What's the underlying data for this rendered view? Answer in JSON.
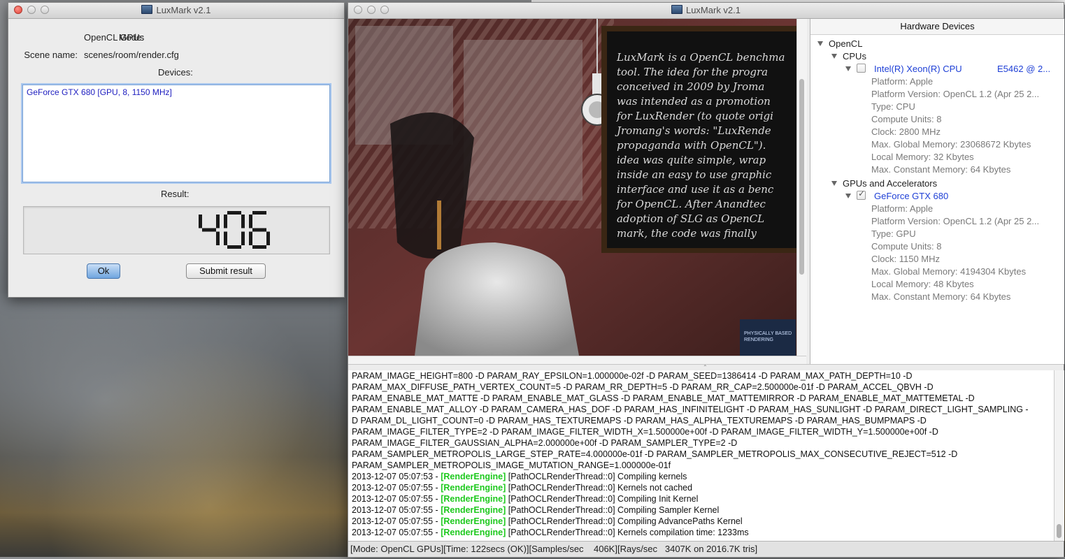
{
  "result_window": {
    "title": "LuxMark v2.1",
    "mode_label": "Mode:",
    "mode_value": "OpenCL GPUs",
    "scene_label": "Scene name:",
    "scene_value": "scenes/room/render.cfg",
    "devices_label": "Devices:",
    "devices": [
      "GeForce GTX 680 [GPU, 8, 1150 MHz]"
    ],
    "result_label": "Result:",
    "result_value": "406",
    "ok_button": "Ok",
    "submit_button": "Submit result"
  },
  "main_window": {
    "title": "LuxMark v2.1",
    "hardware_header": "Hardware Devices",
    "tree": {
      "opencl": "OpenCL",
      "cpus": "CPUs",
      "cpu_device": {
        "name": "Intel(R) Xeon(R) CPU",
        "model": "E5462  @ 2...",
        "checked": false,
        "props": [
          "Platform: Apple",
          "Platform Version: OpenCL 1.2 (Apr 25 2...",
          "Type: CPU",
          "Compute Units: 8",
          "Clock: 2800 MHz",
          "Max. Global Memory: 23068672 Kbytes",
          "Local Memory: 32 Kbytes",
          "Max. Constant Memory: 64 Kbytes"
        ]
      },
      "gpus": "GPUs and Accelerators",
      "gpu_device": {
        "name": "GeForce GTX 680",
        "checked": true,
        "props": [
          "Platform: Apple",
          "Platform Version: OpenCL 1.2 (Apr 25 2...",
          "Type: GPU",
          "Compute Units: 8",
          "Clock: 1150 MHz",
          "Max. Global Memory: 4194304 Kbytes",
          "Local Memory: 48 Kbytes",
          "Max. Constant Memory: 64 Kbytes"
        ]
      }
    },
    "chalkboard_text": [
      "LuxMark is a OpenCL benchma",
      "tool. The idea for the progra",
      "conceived in 2009 by Jroma",
      "was intended as a promotion",
      "for LuxRender (to quote origi",
      "Jromang's words: \"LuxRende",
      "propaganda with OpenCL\").",
      "idea was quite simple, wrap",
      "inside an easy to use graphic",
      "interface and use it as a benc",
      "for OpenCL. After Anandtec",
      "adoption of SLG as OpenCL",
      "mark, the code was finally"
    ],
    "book_text": [
      "PHYSICALLY BASED",
      "RENDERING"
    ],
    "log_lines": [
      {
        "text": "PARAM_IMAGE_HEIGHT=800 -D PARAM_RAY_EPSILON=1.000000e-02f -D PARAM_SEED=1386414 -D PARAM_MAX_PATH_DEPTH=10 -D"
      },
      {
        "text": "PARAM_MAX_DIFFUSE_PATH_VERTEX_COUNT=5 -D PARAM_RR_DEPTH=5 -D PARAM_RR_CAP=2.500000e-01f -D PARAM_ACCEL_QBVH -D"
      },
      {
        "text": "PARAM_ENABLE_MAT_MATTE -D PARAM_ENABLE_MAT_GLASS -D PARAM_ENABLE_MAT_MATTEMIRROR -D PARAM_ENABLE_MAT_MATTEMETAL -D"
      },
      {
        "text": "PARAM_ENABLE_MAT_ALLOY -D PARAM_CAMERA_HAS_DOF -D PARAM_HAS_INFINITELIGHT -D PARAM_HAS_SUNLIGHT -D PARAM_DIRECT_LIGHT_SAMPLING -"
      },
      {
        "text": "D PARAM_DL_LIGHT_COUNT=0 -D PARAM_HAS_TEXTUREMAPS -D PARAM_HAS_ALPHA_TEXTUREMAPS -D PARAM_HAS_BUMPMAPS -D"
      },
      {
        "text": "PARAM_IMAGE_FILTER_TYPE=2 -D PARAM_IMAGE_FILTER_WIDTH_X=1.500000e+00f -D PARAM_IMAGE_FILTER_WIDTH_Y=1.500000e+00f -D"
      },
      {
        "text": "PARAM_IMAGE_FILTER_GAUSSIAN_ALPHA=2.000000e+00f -D PARAM_SAMPLER_TYPE=2 -D"
      },
      {
        "text": "PARAM_SAMPLER_METROPOLIS_LARGE_STEP_RATE=4.000000e-01f -D PARAM_SAMPLER_METROPOLIS_MAX_CONSECUTIVE_REJECT=512 -D"
      },
      {
        "text": "PARAM_SAMPLER_METROPOLIS_IMAGE_MUTATION_RANGE=1.000000e-01f"
      },
      {
        "ts": "2013-12-07 05:07:53 - ",
        "tag": "[RenderEngine]",
        "msg": " [PathOCLRenderThread::0] Compiling kernels"
      },
      {
        "ts": "2013-12-07 05:07:55 - ",
        "tag": "[RenderEngine]",
        "msg": " [PathOCLRenderThread::0] Kernels not cached"
      },
      {
        "ts": "2013-12-07 05:07:55 - ",
        "tag": "[RenderEngine]",
        "msg": " [PathOCLRenderThread::0] Compiling Init Kernel"
      },
      {
        "ts": "2013-12-07 05:07:55 - ",
        "tag": "[RenderEngine]",
        "msg": " [PathOCLRenderThread::0] Compiling Sampler Kernel"
      },
      {
        "ts": "2013-12-07 05:07:55 - ",
        "tag": "[RenderEngine]",
        "msg": " [PathOCLRenderThread::0] Compiling AdvancePaths Kernel"
      },
      {
        "ts": "2013-12-07 05:07:55 - ",
        "tag": "[RenderEngine]",
        "msg": " [PathOCLRenderThread::0] Kernels compilation time: 1233ms"
      }
    ],
    "status": "[Mode: OpenCL GPUs][Time: 122secs (OK)][Samples/sec    406K][Rays/sec   3407K on 2016.7K tris]"
  },
  "colors": {
    "log_tag": "#1ec91e",
    "device_link": "#1f40d6"
  }
}
